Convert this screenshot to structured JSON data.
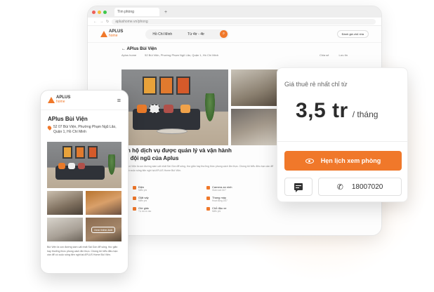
{
  "browser": {
    "tab_title": "Tìm phòng",
    "url": "aplushome.vn/phong"
  },
  "site": {
    "logo_main": "APLUS",
    "logo_sub": "home",
    "search_location": "Hồ Chí Minh",
    "search_price": "Từ 4tr - 4tr",
    "header_button": "Đánh giá chủ nhà"
  },
  "listing": {
    "title": "APlus Bùi Viện",
    "meta_brand": "Aplus home",
    "address": "52 Bùi Viện, Phường Phạm Ngũ Lão, Quận 1, Hồ Chí Minh",
    "share": "Chia sẻ",
    "save": "Lưu tin"
  },
  "content": {
    "headline_1": "n hộ dịch vụ được quản lý và vận hành",
    "headline_2": "i đội ngũ của Aplus",
    "desc": "Bùi Viện là con đường sầm uất nhất Sài Gòn để sống, thư giãn hay thưởng thức phong cách ẩm thực. Chúng tôi hiểu điều bạn cần để có cuộc sống tiện nghi tại APLUS Home Bùi Viện."
  },
  "amenities": [
    {
      "title": "Điện",
      "sub": "Miễn phí",
      "icon": "plug-icon"
    },
    {
      "title": "Camera an ninh",
      "sub": "Giám sát 24/7",
      "icon": "camera-icon"
    },
    {
      "title": "Giặt sấy",
      "sub": "Miễn phí",
      "icon": "washer-icon"
    },
    {
      "title": "Thang máy",
      "sub": "Hoạt động 24/7",
      "icon": "elevator-icon"
    },
    {
      "title": "Giờ giấc",
      "sub": "Tự do ra vào",
      "icon": "clock-icon"
    },
    {
      "title": "Chỗ đậu xe",
      "sub": "Miễn phí",
      "icon": "parking-icon"
    }
  ],
  "mobile": {
    "logo_main": "APLUS",
    "logo_sub": "home",
    "title": "APlus Bùi Viện",
    "address": "52 07 Bùi Viện, Phường Phạm Ngũ Lão, Quận 1, Hồ Chí Minh",
    "more_photos": "Xem thêm ảnh",
    "desc": "Bùi Viện là con đường sầm uất nhất Sài Gòn để sống, thư giãn hay thưởng thức phong cách ẩm thực. Chúng tôi hiểu điều bạn cần để có cuộc sống tiện nghi tại APLUS Home Bùi Viện."
  },
  "card": {
    "label": "Giá thuê rẻ nhất chỉ từ",
    "price": "3,5 tr",
    "unit": "/ tháng",
    "book_label": "Hẹn lịch xem phòng",
    "phone": "18007020"
  },
  "colors": {
    "accent": "#f0782a"
  }
}
